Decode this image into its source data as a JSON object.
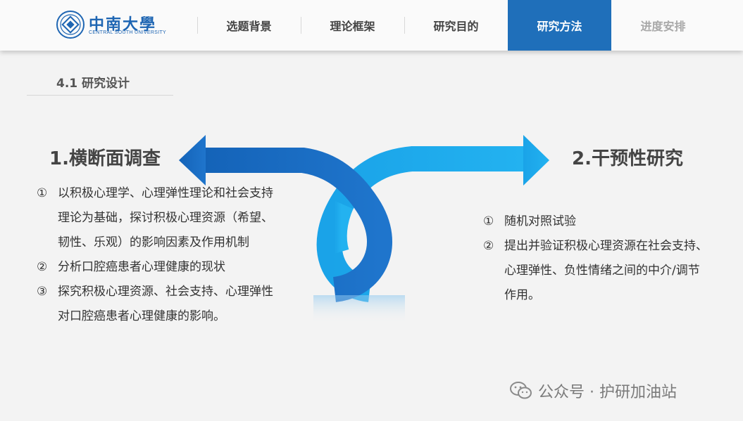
{
  "header": {
    "logo": {
      "cn": "中南大學",
      "en": "CENTRAL SOUTH UNIVERSITY"
    },
    "nav": [
      {
        "label": "选题背景",
        "state": "normal"
      },
      {
        "label": "理论框架",
        "state": "normal"
      },
      {
        "label": "研究目的",
        "state": "normal"
      },
      {
        "label": "研究方法",
        "state": "active"
      },
      {
        "label": "进度安排",
        "state": "muted"
      }
    ]
  },
  "section": {
    "title": "4.1  研究设计"
  },
  "left": {
    "heading": "1.横断面调查",
    "items": [
      {
        "num": "①",
        "text": "以积极心理学、心理弹性理论和社会支持理论为基础，探讨积极心理资源（希望、韧性、乐观）的影响因素及作用机制"
      },
      {
        "num": "②",
        "text": "分析口腔癌患者心理健康的现状"
      },
      {
        "num": "③",
        "text": "探究积极心理资源、社会支持、心理弹性对口腔癌患者心理健康的影响。"
      }
    ]
  },
  "right": {
    "heading": "2.干预性研究",
    "items": [
      {
        "num": "①",
        "text": "随机对照试验"
      },
      {
        "num": "②",
        "text": "提出并验证积极心理资源在社会支持、心理弹性、负性情绪之间的中介/调节作用。"
      }
    ]
  },
  "watermark": {
    "text": "公众号 · 护研加油站"
  },
  "colors": {
    "accent": "#1f6fba",
    "arrow_dark": "#1b6cc0",
    "arrow_light": "#1ea7ea"
  }
}
